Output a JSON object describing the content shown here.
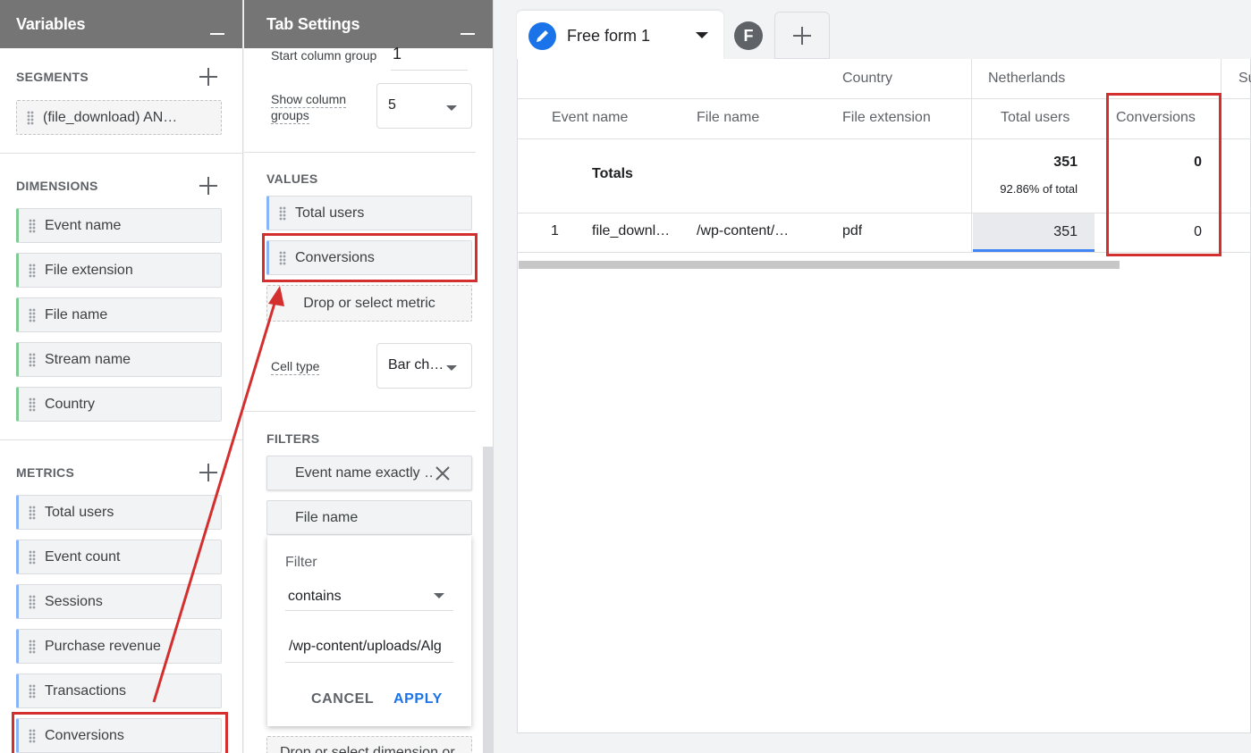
{
  "variables": {
    "title": "Variables",
    "segments": {
      "label": "SEGMENTS",
      "items": [
        "(file_download) AN…"
      ]
    },
    "dimensions": {
      "label": "DIMENSIONS",
      "items": [
        "Event name",
        "File extension",
        "File name",
        "Stream name",
        "Country"
      ]
    },
    "metrics": {
      "label": "METRICS",
      "items": [
        "Total users",
        "Event count",
        "Sessions",
        "Purchase revenue",
        "Transactions",
        "Conversions"
      ]
    }
  },
  "tab_settings": {
    "title": "Tab Settings",
    "start_column_group_label": "Start column group",
    "start_column_group_value": "1",
    "show_column_groups_label_1": "Show column",
    "show_column_groups_label_2": "groups",
    "show_column_groups_value": "5",
    "values_label": "VALUES",
    "values": [
      "Total users",
      "Conversions"
    ],
    "drop_metric": "Drop or select metric",
    "cell_type_label": "Cell type",
    "cell_type_value": "Bar ch…",
    "filters_label": "FILTERS",
    "filters": [
      "Event name exactly …",
      "File name"
    ],
    "filter_popup": {
      "heading": "Filter",
      "match_type": "contains",
      "value": "/wp-content/uploads/Alg",
      "cancel": "CANCEL",
      "apply": "APPLY"
    },
    "drop_dimension": "Drop or select dimension or"
  },
  "main": {
    "tabs": [
      {
        "label": "Free form 1",
        "icon": "pencil-icon"
      },
      {
        "label": "F",
        "icon": "avatar"
      }
    ],
    "add_tab_icon": "plus-icon",
    "table": {
      "group_header_dimension": "Country",
      "group_header_value": "Netherlands",
      "group_header_next": "Su",
      "columns": [
        "Event name",
        "File name",
        "File extension",
        "Total users",
        "Conversions"
      ],
      "totals": {
        "label": "Totals",
        "total_users": "351",
        "total_users_pct": "92.86% of total",
        "conversions": "0"
      },
      "rows": [
        {
          "index": "1",
          "event_name": "file_downl…",
          "file_name": "/wp-content/…",
          "file_extension": "pdf",
          "total_users": "351",
          "conversions": "0"
        }
      ]
    }
  },
  "colors": {
    "header_gray": "#757575",
    "accent_blue": "#1a73e8",
    "highlight_red": "#d32f2f",
    "dimension_green": "#81c995",
    "metric_blue": "#8ab4f8"
  }
}
